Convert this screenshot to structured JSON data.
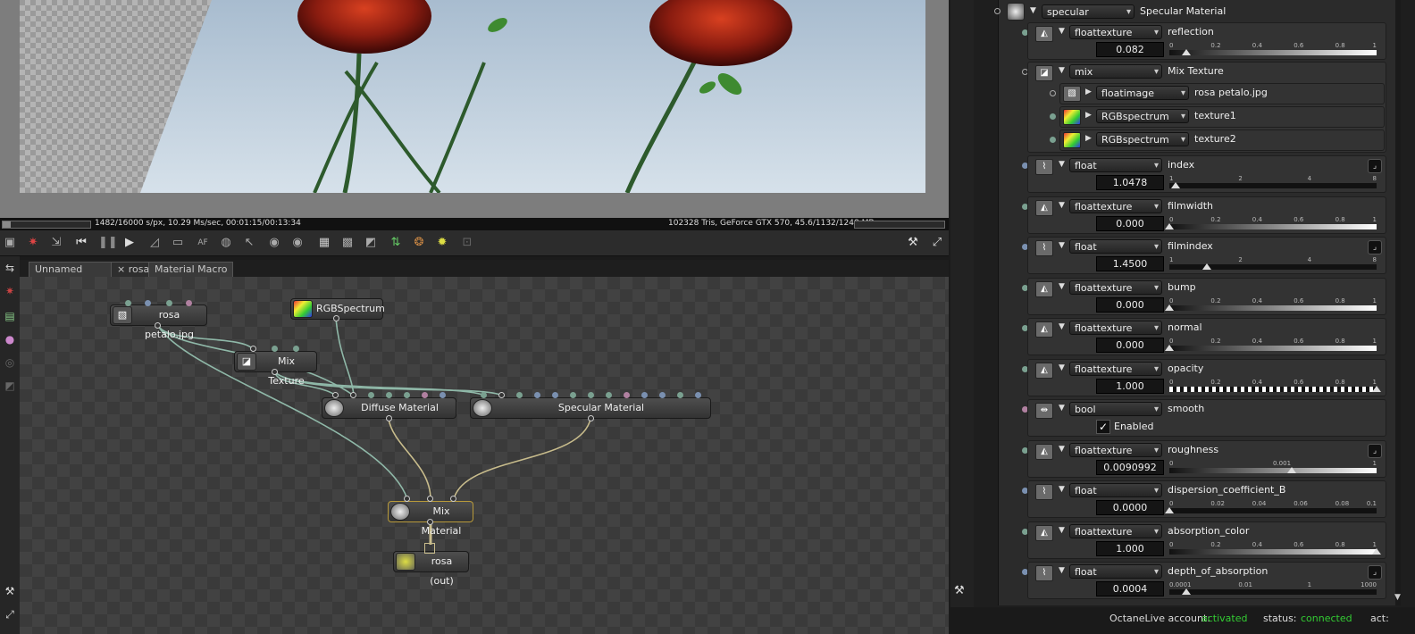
{
  "statusbar": {
    "left": "1482/16000 s/px, 10.29 Ms/sec, 00:01:15/00:13:34",
    "right": "102328 Tris, GeForce GTX 570, 45.6/1132/1248 MB",
    "progress_fraction": 0.093
  },
  "tabs": [
    "Unnamed Project",
    "rosa",
    "Material Macro"
  ],
  "tab_close": "×",
  "nodes": {
    "rosa_petalo": "rosa petalo.jpg",
    "rgbspectrum": "RGBSpectrum",
    "mix_texture": "Mix Texture",
    "diffuse_material": "Diffuse Material",
    "specular_material": "Specular Material",
    "mix_material": "Mix Material",
    "rosa_out": "rosa (out)"
  },
  "inspector": {
    "header": {
      "type": "specular",
      "name": "Specular Material"
    },
    "reflection": {
      "type": "floattexture",
      "name": "reflection",
      "value": "0.082",
      "ticks": [
        "0",
        "0.2",
        "0.4",
        "0.6",
        "0.8",
        "1"
      ],
      "level": 0.082
    },
    "mix": {
      "type": "mix",
      "name": "Mix Texture"
    },
    "sub1": {
      "type": "floatimage",
      "name": "rosa petalo.jpg"
    },
    "sub2": {
      "type": "RGBspectrum",
      "name": "texture1"
    },
    "sub3": {
      "type": "RGBspectrum",
      "name": "texture2"
    },
    "index": {
      "type": "float",
      "name": "index",
      "value": "1.0478",
      "ticks": [
        "1",
        "2",
        "4",
        "8"
      ],
      "level": 0.03
    },
    "filmwidth": {
      "type": "floattexture",
      "name": "filmwidth",
      "value": "0.000",
      "ticks": [
        "0",
        "0.2",
        "0.4",
        "0.6",
        "0.8",
        "1"
      ],
      "level": 0
    },
    "filmindex": {
      "type": "float",
      "name": "filmindex",
      "value": "1.4500",
      "ticks": [
        "1",
        "2",
        "4",
        "8"
      ],
      "level": 0.18
    },
    "bump": {
      "type": "floattexture",
      "name": "bump",
      "value": "0.000",
      "ticks": [
        "0",
        "0.2",
        "0.4",
        "0.6",
        "0.8",
        "1"
      ],
      "level": 0
    },
    "normal": {
      "type": "floattexture",
      "name": "normal",
      "value": "0.000",
      "ticks": [
        "0",
        "0.2",
        "0.4",
        "0.6",
        "0.8",
        "1"
      ],
      "level": 0
    },
    "opacity": {
      "type": "floattexture",
      "name": "opacity",
      "value": "1.000",
      "ticks": [
        "0",
        "0.2",
        "0.4",
        "0.6",
        "0.8",
        "1"
      ],
      "level": 1
    },
    "smooth": {
      "type": "bool",
      "name": "smooth",
      "check_label": "Enabled",
      "checked": true
    },
    "roughness": {
      "type": "floattexture",
      "name": "roughness",
      "value": "0.0090992",
      "ticks": [
        "0",
        "0.001",
        "1"
      ],
      "level": 0.59
    },
    "dispersion": {
      "type": "float",
      "name": "dispersion_coefficient_B",
      "value": "0.0000",
      "ticks": [
        "0",
        "0.02",
        "0.04",
        "0.06",
        "0.08",
        "0.1"
      ],
      "level": 0
    },
    "absorption": {
      "type": "floattexture",
      "name": "absorption_color",
      "value": "1.000",
      "ticks": [
        "0",
        "0.2",
        "0.4",
        "0.6",
        "0.8",
        "1"
      ],
      "level": 1
    },
    "depth": {
      "type": "float",
      "name": "depth_of_absorption",
      "value": "0.0004",
      "ticks": [
        "0.0001",
        "0.01",
        "1",
        "1000"
      ],
      "level": 0.08
    }
  },
  "footer": {
    "account_label": "OctaneLive account:",
    "account_value": "activated",
    "status_label": "status:",
    "status_value": "connected",
    "act_label": "act:"
  },
  "colors": {
    "accent_green": "#33cc33",
    "pin_green": "#7aa090",
    "pin_blue": "#7a90b0",
    "pin_pink": "#b080a0",
    "wire": "#8fb8a8",
    "wire_mat": "#c8bc8c"
  }
}
